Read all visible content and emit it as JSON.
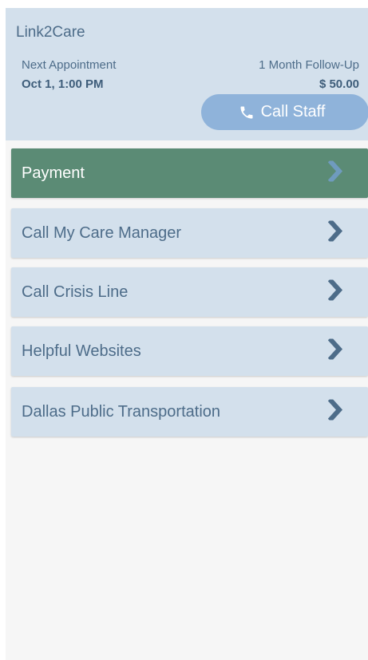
{
  "app": {
    "title": "Link2Care"
  },
  "appointment": {
    "label": "Next Appointment",
    "time": "Oct 1, 1:00 PM",
    "type": "1 Month Follow-Up",
    "price": "$ 50.00"
  },
  "call_staff": {
    "label": "Call Staff",
    "icon": "phone-icon"
  },
  "menu": {
    "items": [
      {
        "label": "Payment",
        "active": true
      },
      {
        "label": "Call My Care Manager",
        "active": false
      },
      {
        "label": "Call Crisis Line",
        "active": false
      },
      {
        "label": "Helpful Websites",
        "active": false
      },
      {
        "label": "Dallas Public Transportation",
        "active": false
      }
    ],
    "chevron_icon": "chevron-right-icon"
  },
  "colors": {
    "header_bg": "#d3e0ec",
    "accent_text": "#4d6c89",
    "active_item": "#5b8b75",
    "button_bg": "#8fb3da",
    "page_bg": "#f6f6f6"
  }
}
